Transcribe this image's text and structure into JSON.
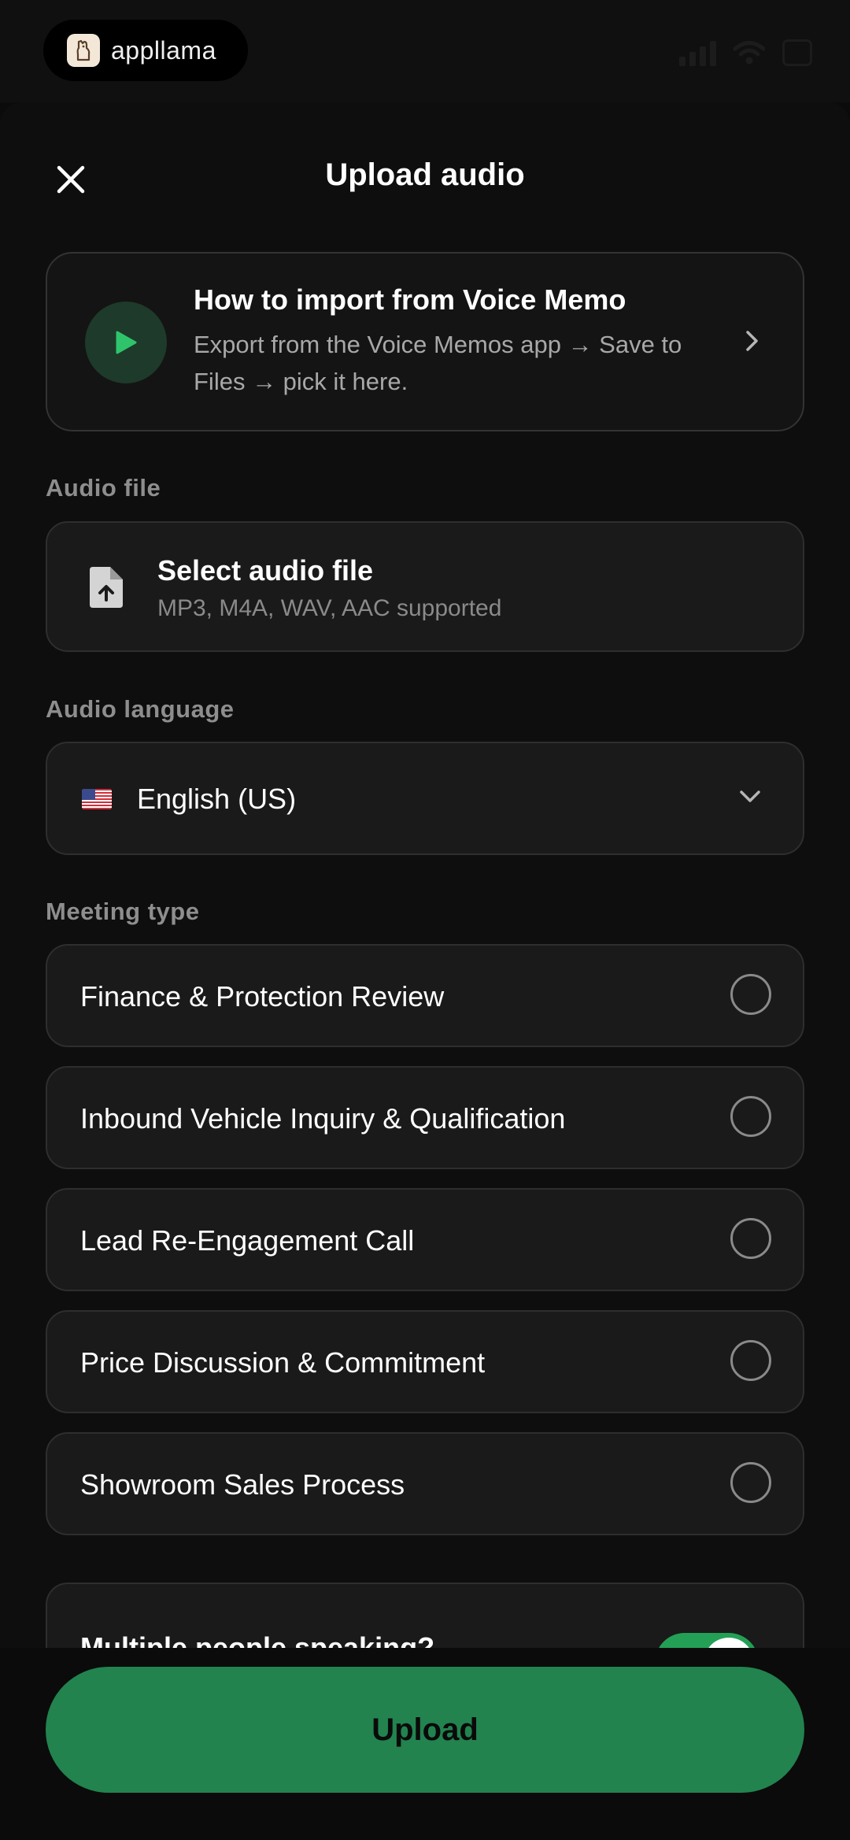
{
  "status_bar": {
    "brand_name": "appllama",
    "icons": [
      "signal-icon",
      "wifi-icon",
      "battery-icon"
    ]
  },
  "header": {
    "title": "Upload audio",
    "close_icon": "close-icon"
  },
  "info_card": {
    "title": "How to import from Voice Memo",
    "description": "Export from the Voice Memos app → Save to Files → pick it here.",
    "icon": "play-icon"
  },
  "audio_file": {
    "section_label": "Audio file",
    "title": "Select audio file",
    "subtitle": "MP3, M4A, WAV, AAC supported",
    "icon": "file-upload-icon"
  },
  "audio_language": {
    "section_label": "Audio language",
    "selected": "English (US)",
    "flag_icon": "us-flag-icon"
  },
  "meeting_type": {
    "section_label": "Meeting type",
    "options": [
      {
        "label": "Finance & Protection Review",
        "selected": false
      },
      {
        "label": "Inbound Vehicle Inquiry & Qualification",
        "selected": false
      },
      {
        "label": "Lead Re-Engagement Call",
        "selected": false
      },
      {
        "label": "Price Discussion & Commitment",
        "selected": false
      },
      {
        "label": "Showroom Sales Process",
        "selected": false
      }
    ]
  },
  "multiple_speakers": {
    "label": "Multiple people speaking?",
    "enabled": true
  },
  "footer": {
    "upload_label": "Upload"
  },
  "colors": {
    "accent": "#22834f",
    "toggle_on": "#24a056",
    "background": "#0e0e0e",
    "card": "#1a1a1a"
  }
}
